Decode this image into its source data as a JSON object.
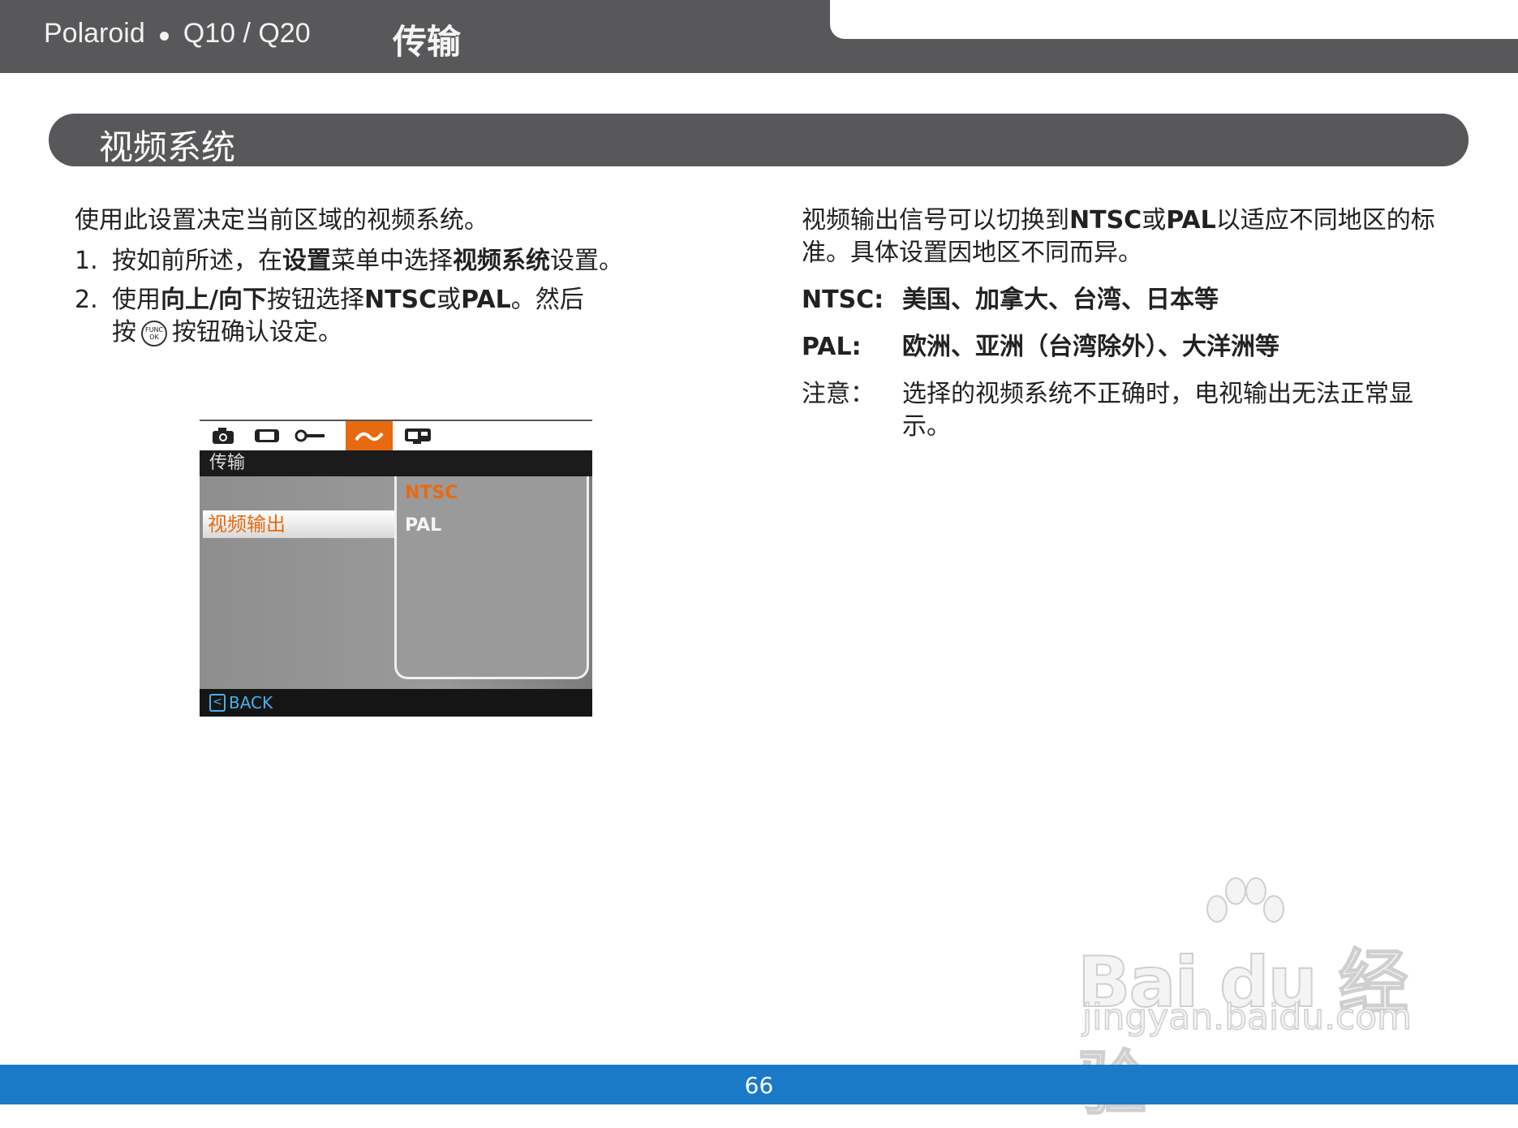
{
  "header": {
    "brand": "Polaroid",
    "model": "Q10 / Q20",
    "chapter": "传输"
  },
  "section": {
    "title": "视频系统"
  },
  "left": {
    "intro": "使用此设置决定当前区域的视频系统。",
    "step1": {
      "num": "1.",
      "t1": "按如前所述，在",
      "b1": "设置",
      "t2": "菜单中选择",
      "b2": "视频系统",
      "t3": "设置。"
    },
    "step2": {
      "num": "2.",
      "t1": "使用",
      "b1": "向上/向下",
      "t2": "按钮选择",
      "b2": "NTSC",
      "t3": "或",
      "b3": "PAL",
      "t4": "。然后",
      "t5": "按",
      "t6": "按钮确认设定。",
      "icon_top": "FUNC",
      "icon_bottom": "OK"
    }
  },
  "screen": {
    "tabs": [
      "camera-icon",
      "playback-icon",
      "wrench-icon",
      "transfer-icon",
      "card-icon"
    ],
    "active_tab": 3,
    "header": "传输",
    "item": "视频输出",
    "options": [
      "NTSC",
      "PAL"
    ],
    "selected_option": "NTSC",
    "back": "BACK",
    "accent": "#e86a10",
    "back_color": "#4ab0e6"
  },
  "right": {
    "intro_t1": "视频输出信号可以切换到",
    "intro_b1": "NTSC",
    "intro_t2": "或",
    "intro_b2": "PAL",
    "intro_t3": "以适应不同地区的标准。具体设置因地区不同而异。",
    "ntsc_term": "NTSC:",
    "ntsc_desc": "美国、加拿大、台湾、日本等",
    "pal_term": "PAL:",
    "pal_desc": "欧洲、亚洲（台湾除外）、大洋洲等",
    "note_term": "注意：",
    "note_desc": "选择的视频系统不正确时，电视输出无法正常显示。"
  },
  "watermark": {
    "main": "Bai du 经验",
    "sub": "jingyan.baidu.com"
  },
  "footer": {
    "page": "66",
    "color": "#1a7ac8"
  }
}
